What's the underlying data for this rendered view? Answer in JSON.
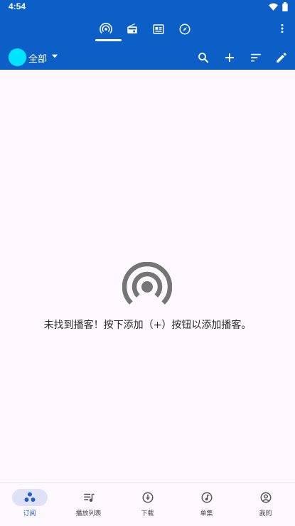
{
  "status": {
    "time": "4:54"
  },
  "appbar": {
    "tabs": [
      {
        "icon": "podcast-icon"
      },
      {
        "icon": "radio-icon"
      },
      {
        "icon": "article-icon"
      },
      {
        "icon": "explore-icon"
      }
    ],
    "filter": {
      "label": "全部"
    },
    "actions": [
      "search-icon",
      "add-icon",
      "sort-icon",
      "edit-icon"
    ]
  },
  "empty": {
    "message": "未找到播客！按下添加（+）按钮以添加播客。"
  },
  "bottom_nav": {
    "items": [
      {
        "label": "订阅",
        "icon": "subscriptions-icon",
        "active": true
      },
      {
        "label": "播放列表",
        "icon": "playlist-icon",
        "active": false
      },
      {
        "label": "下载",
        "icon": "download-icon",
        "active": false
      },
      {
        "label": "单集",
        "icon": "episodes-icon",
        "active": false
      },
      {
        "label": "我的",
        "icon": "account-icon",
        "active": false
      }
    ]
  },
  "colors": {
    "primary": "#0b5fc6",
    "accent": "#00e5ff",
    "background": "#fdf8fd"
  }
}
